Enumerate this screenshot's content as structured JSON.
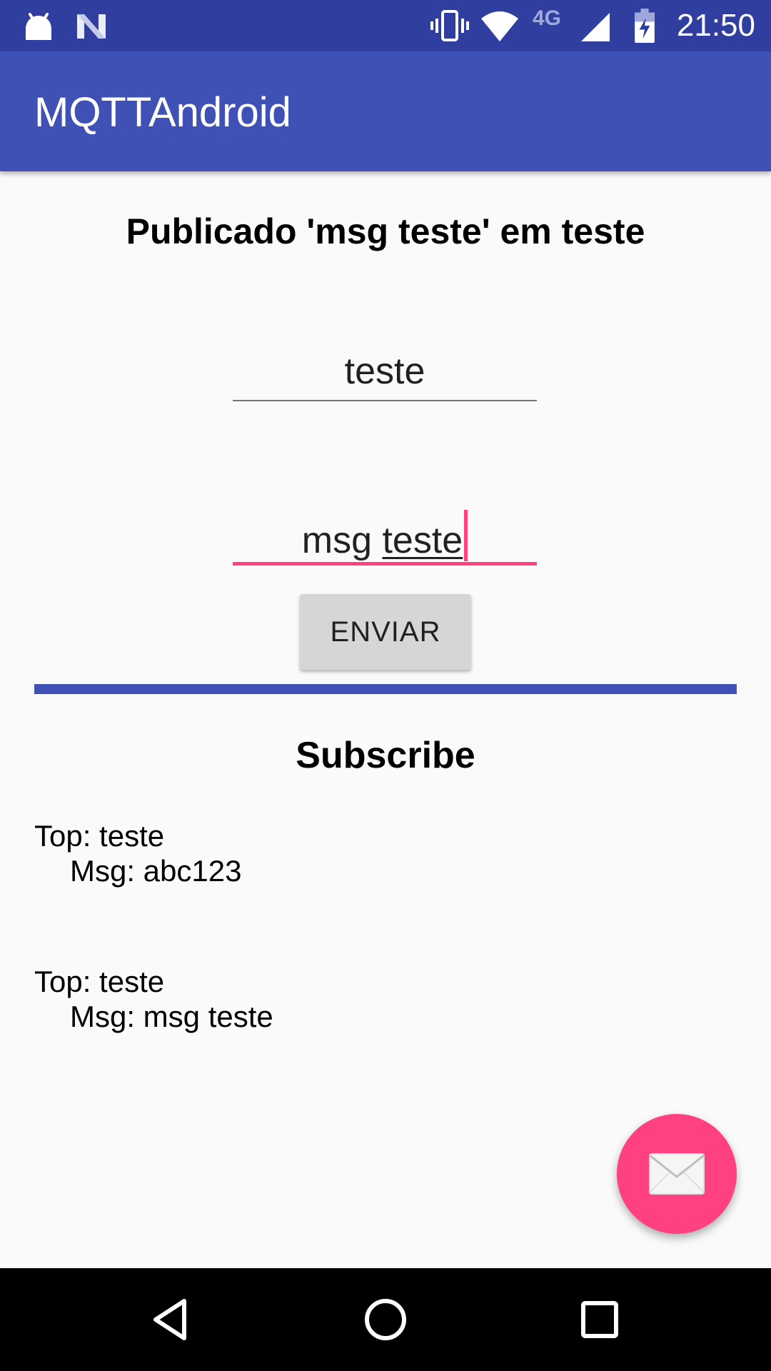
{
  "status_bar": {
    "time": "21:50",
    "network_type": "4G",
    "icons": [
      "android-icon",
      "n-icon",
      "vibrate-icon",
      "wifi-icon",
      "signal-icon",
      "battery-charging-icon"
    ]
  },
  "app_bar": {
    "title": "MQTTAndroid"
  },
  "publish": {
    "status_text": "Publicado 'msg teste' em teste",
    "topic_value": "teste",
    "message_prefix": "msg",
    "message_word": "teste",
    "send_label": "ENVIAR"
  },
  "subscribe": {
    "title": "Subscribe",
    "entries": [
      {
        "topic": "Top: teste",
        "message": "Msg: abc123"
      },
      {
        "topic": "Top: teste",
        "message": "Msg: msg teste"
      }
    ]
  },
  "fab": {
    "icon": "email-icon"
  },
  "nav_bar": {
    "buttons": [
      "back-icon",
      "home-icon",
      "recents-icon"
    ]
  },
  "colors": {
    "status_bar": "#303f9f",
    "app_bar": "#3f51b5",
    "accent": "#ff4081",
    "divider": "#3f51b5",
    "button": "#d6d6d6"
  }
}
